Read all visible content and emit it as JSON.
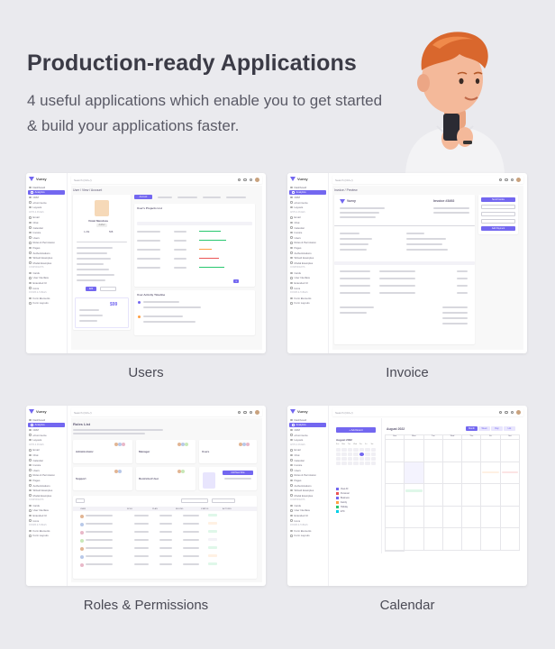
{
  "hero": {
    "title": "Production-ready Applications",
    "subtitle": "4 useful applications which enable you to get started & build your applications faster."
  },
  "apps": [
    {
      "label": "Users"
    },
    {
      "label": "Invoice"
    },
    {
      "label": "Roles & Permissions"
    },
    {
      "label": "Calendar"
    }
  ],
  "mini": {
    "brand": "Vuexy",
    "search": "Search (Ctrl+/)",
    "users": {
      "breadcrumb": "User / View / Account",
      "name": "Violet Mendoza",
      "role": "Author",
      "stats": [
        "1.23k",
        "568"
      ],
      "price": "$99",
      "table_title": "User's Projects List",
      "timeline_title": "User Activity Timeline",
      "edit": "Edit",
      "suspend": "Suspended"
    },
    "invoice": {
      "breadcrumb": "Invoice / Preview",
      "number": "Invoice #3492",
      "actions": [
        "Send Invoice",
        "Download",
        "Print",
        "Edit Invoice",
        "Add Payment"
      ]
    },
    "roles": {
      "title": "Roles List",
      "role_cards": [
        "Administrator",
        "Manager",
        "Users",
        "Support",
        "Restricted User"
      ],
      "add_role": "Add New Role",
      "table_head": [
        "USER",
        "ROLE",
        "PLAN",
        "BILLING",
        "STATUS",
        "ACTIONS"
      ]
    },
    "calendar": {
      "add_event": "+ Add Event",
      "month": "August 2022",
      "views": [
        "Month",
        "Week",
        "Day",
        "List"
      ],
      "filters": [
        "View All",
        "Personal",
        "Business",
        "Family",
        "Holiday",
        "ETC"
      ],
      "days": [
        "Sun",
        "Mon",
        "Tue",
        "Wed",
        "Thu",
        "Fri",
        "Sat"
      ]
    }
  },
  "colors": {
    "primary": "#7367f0",
    "background": "#eaeaee",
    "skin": "#f4b99a",
    "hair": "#d9672d"
  }
}
